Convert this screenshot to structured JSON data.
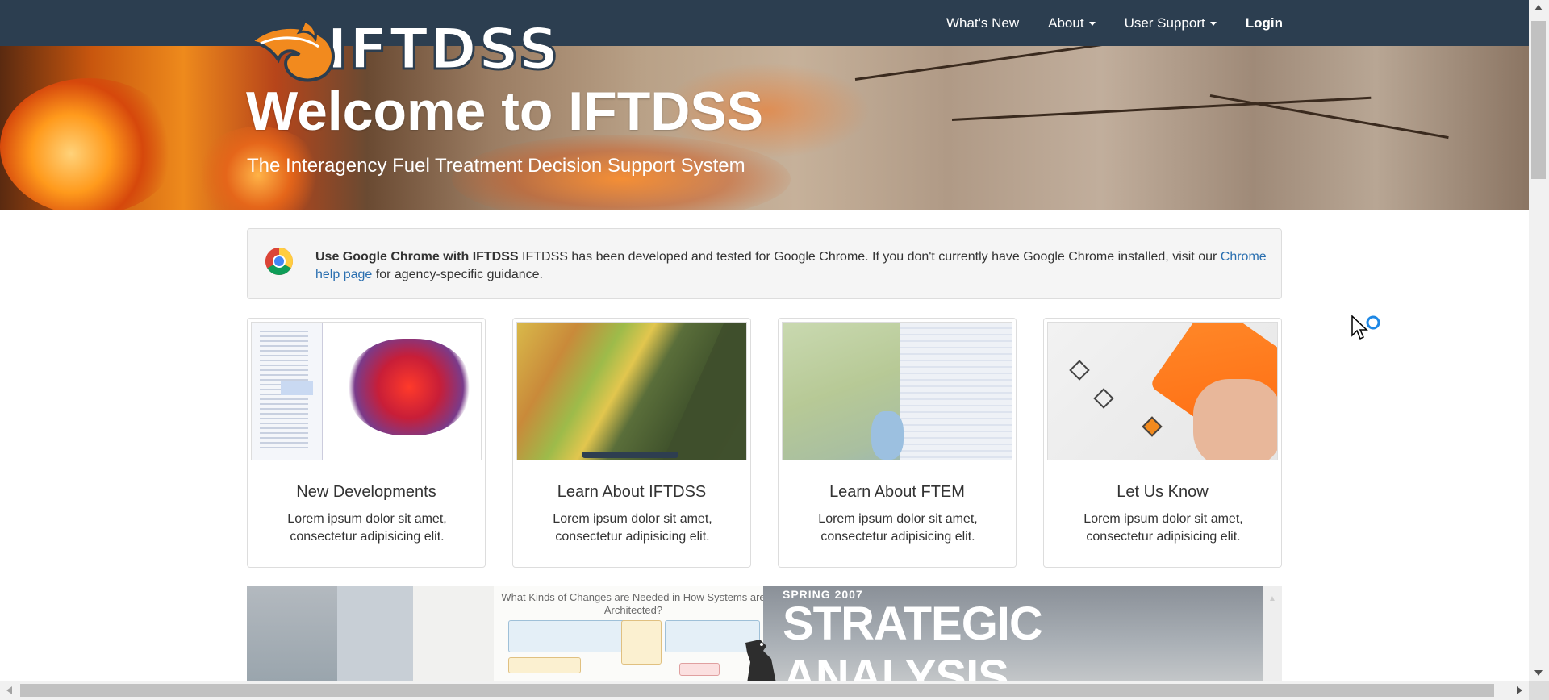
{
  "nav": {
    "items": [
      {
        "label": "What's New",
        "dropdown": false
      },
      {
        "label": "About",
        "dropdown": true
      },
      {
        "label": "User Support",
        "dropdown": true
      }
    ],
    "login": "Login"
  },
  "logo": {
    "text": "IFTDSS"
  },
  "hero": {
    "title": "Welcome to IFTDSS",
    "subtitle": "The Interagency Fuel Treatment Decision Support System"
  },
  "alert": {
    "icon": "chrome-icon",
    "bold": "Use Google Chrome with IFTDSS",
    "text": " IFTDSS has been developed and tested for Google Chrome. If you don't currently have Google Chrome installed, visit our ",
    "link": "Chrome help page",
    "tail": " for agency-specific guidance."
  },
  "cards": [
    {
      "title": "New Developments",
      "text": "Lorem ipsum dolor sit amet, consectetur adipisicing elit."
    },
    {
      "title": "Learn About IFTDSS",
      "text": "Lorem ipsum dolor sit amet, consectetur adipisicing elit."
    },
    {
      "title": "Learn About FTEM",
      "text": "Lorem ipsum dolor sit amet, consectetur adipisicing elit."
    },
    {
      "title": "Let Us Know",
      "text": "Lorem ipsum dolor sit amet, consectetur adipisicing elit."
    }
  ],
  "banner": {
    "slide_title": "What Kinds of Changes are Needed in How Systems are Architected?",
    "season": "SPRING 2007",
    "headline_1": "STRATEGIC",
    "headline_2": "ANALYSIS"
  },
  "colors": {
    "navbar": "#2c3e50",
    "link": "#2a6fb0",
    "accent_orange": "#f28a1e"
  }
}
